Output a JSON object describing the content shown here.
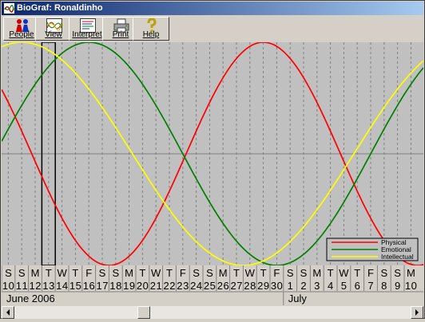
{
  "window": {
    "title": "BioGraf: Ronaldinho"
  },
  "toolbar": {
    "buttons": [
      {
        "label": "People",
        "icon": "people-icon"
      },
      {
        "label": "View",
        "icon": "view-chart-icon"
      },
      {
        "label": "Interpret",
        "icon": "interpret-icon"
      },
      {
        "label": "Print",
        "icon": "printer-icon"
      },
      {
        "label": "Help",
        "icon": "help-icon"
      }
    ]
  },
  "chart_data": {
    "type": "line",
    "x": [
      "2006-06-10",
      "2006-06-11",
      "2006-06-12",
      "2006-06-13",
      "2006-06-14",
      "2006-06-15",
      "2006-06-16",
      "2006-06-17",
      "2006-06-18",
      "2006-06-19",
      "2006-06-20",
      "2006-06-21",
      "2006-06-22",
      "2006-06-23",
      "2006-06-24",
      "2006-06-25",
      "2006-06-26",
      "2006-06-27",
      "2006-06-28",
      "2006-06-29",
      "2006-06-30",
      "2006-07-01",
      "2006-07-02",
      "2006-07-03",
      "2006-07-04",
      "2006-07-05",
      "2006-07-06",
      "2006-07-07",
      "2006-07-08",
      "2006-07-09",
      "2006-07-10"
    ],
    "weekdays": [
      "S",
      "S",
      "M",
      "T",
      "W",
      "T",
      "F",
      "S",
      "S",
      "M",
      "T",
      "W",
      "T",
      "F",
      "S",
      "S",
      "M",
      "T",
      "W",
      "T",
      "F",
      "S",
      "S",
      "M",
      "T",
      "W",
      "T",
      "F",
      "S",
      "S",
      "M"
    ],
    "daynums": [
      "10",
      "11",
      "12",
      "13",
      "14",
      "15",
      "16",
      "17",
      "18",
      "19",
      "20",
      "21",
      "22",
      "23",
      "24",
      "25",
      "26",
      "27",
      "28",
      "29",
      "30",
      "1",
      "2",
      "3",
      "4",
      "5",
      "6",
      "7",
      "8",
      "9",
      "10"
    ],
    "months": [
      {
        "label": "June 2006",
        "start_index": 0
      },
      {
        "label": "July",
        "start_index": 21
      }
    ],
    "selected_day_index": 3,
    "ylim": [
      -1,
      1
    ],
    "series": [
      {
        "name": "Physical",
        "color": "#ff0000",
        "period_days": 23,
        "peak_date": "2006-06-29"
      },
      {
        "name": "Emotional",
        "color": "#008000",
        "period_days": 28,
        "peak_date": "2006-06-16"
      },
      {
        "name": "Intellectual",
        "color": "#ffff00",
        "period_days": 33,
        "peak_date": "2006-06-11"
      }
    ],
    "legend_position": "bottom-right",
    "grid": true
  },
  "colors": {
    "plot_bg": "#c0c0c0",
    "grid_line": "#808080",
    "title_start": "#0a246a",
    "title_end": "#a6caf0"
  }
}
